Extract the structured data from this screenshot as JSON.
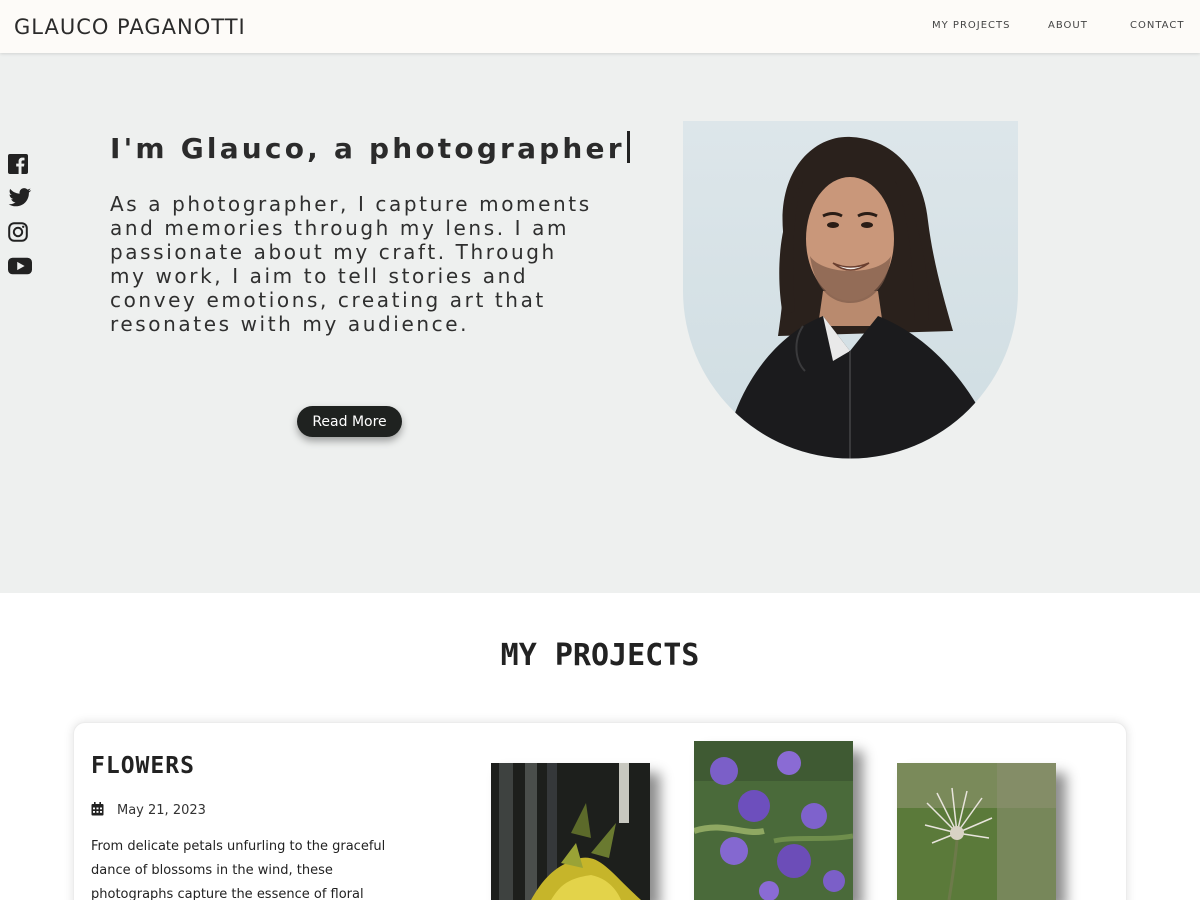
{
  "header": {
    "brand": "GLAUCO PAGANOTTI",
    "nav": [
      "MY PROJECTS",
      "ABOUT",
      "CONTACT"
    ]
  },
  "social": [
    "facebook-icon",
    "twitter-icon",
    "instagram-icon",
    "youtube-icon"
  ],
  "hero": {
    "title": "I'm Glauco, a photographer",
    "text": "As a photographer, I capture moments and memories through my lens. I am passionate about my craft. Through my work, I aim to tell stories and convey emotions, creating art that resonates with my audience.",
    "button": "Read More"
  },
  "projects": {
    "title": "MY PROJECTS",
    "card": {
      "title": "FLOWERS",
      "date": "May 21, 2023",
      "text": "From delicate petals unfurling to the graceful dance of blossoms in the wind, these photographs capture the essence of floral"
    }
  },
  "colors": {
    "hero_bg": "#eef0ef",
    "button_bg": "#1f2220",
    "header_bg": "#fdfbf8"
  }
}
